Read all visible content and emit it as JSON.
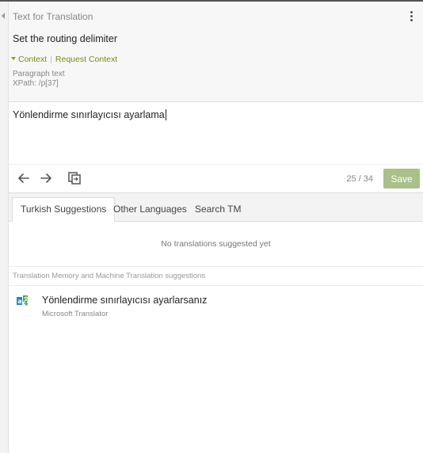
{
  "source": {
    "title": "Text for Translation",
    "text": "Set the routing delimiter",
    "context_link": "Context",
    "context_sep": "|",
    "request_context_link": "Request Context",
    "paragraph_label": "Paragraph text",
    "xpath": "XPath: /p[37]"
  },
  "target": {
    "text": "Yönlendirme sınırlayıcısı ayarlama"
  },
  "toolbar": {
    "counter": "25 / 34",
    "save_label": "Save",
    "save_color": "#a9c08a"
  },
  "tabs": [
    {
      "label": "Turkish Suggestions",
      "active": true
    },
    {
      "label": "Other Languages",
      "active": false
    },
    {
      "label": "Search TM",
      "active": false
    }
  ],
  "suggestions": {
    "empty_message": "No translations suggested yet",
    "tm_header": "Translation Memory and Machine Translation suggestions",
    "items": [
      {
        "text": "Yönlendirme sınırlayıcısı ayarlarsanız",
        "source": "Microsoft Translator",
        "icon": "translator-icon"
      }
    ]
  },
  "colors": {
    "accent": "#8a9a1e",
    "translator_blue": "#1e88c8",
    "translator_green": "#3ba54a"
  }
}
